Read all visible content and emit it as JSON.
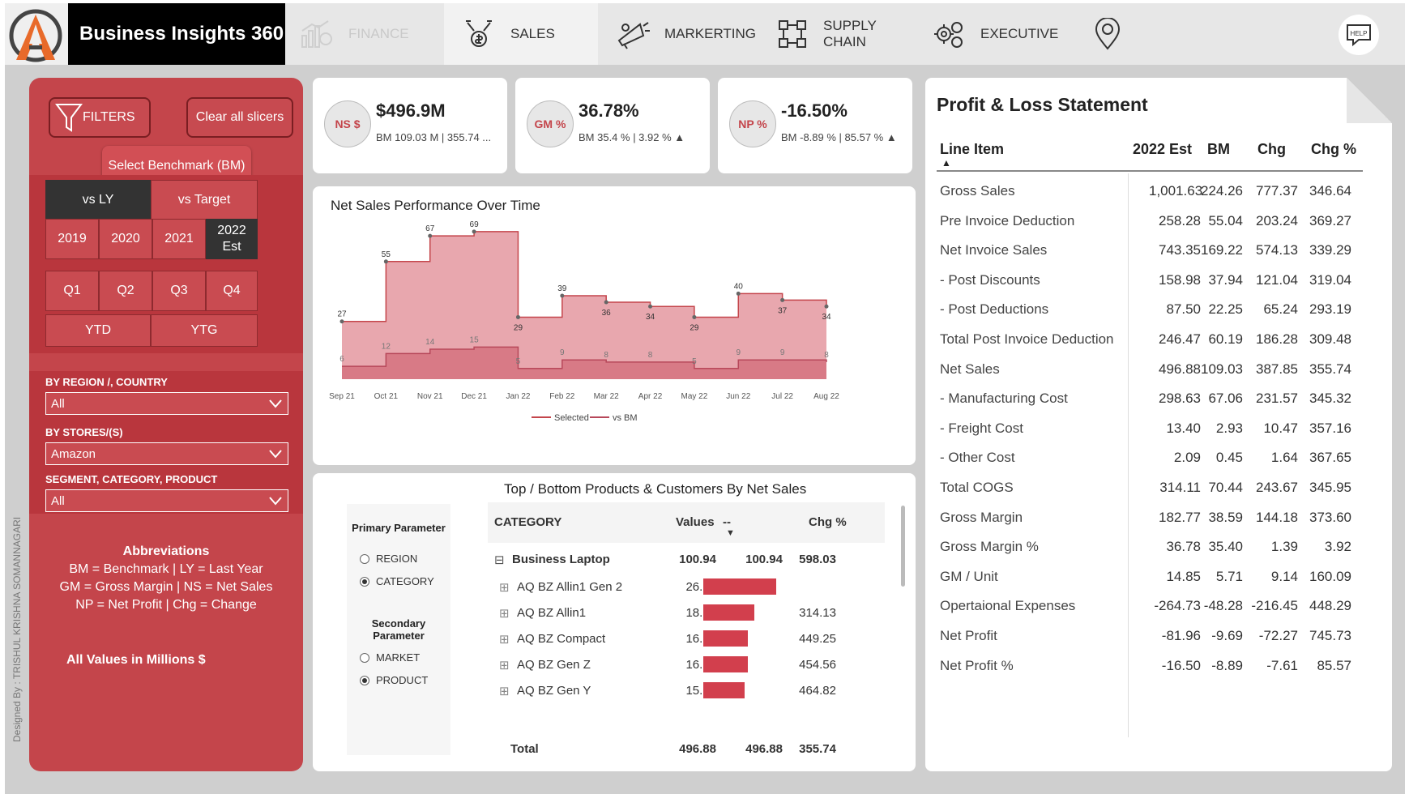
{
  "header": {
    "brand": "Business Insights 360",
    "nav": {
      "finance": "FINANCE",
      "sales": "SALES",
      "marketing": "MARKERTING",
      "supply_chain": "SUPPLY CHAIN",
      "executive": "EXECUTIVE"
    },
    "help_label": "HELP"
  },
  "filters": {
    "filters_label": "FILTERS",
    "clear_label": "Clear all slicers",
    "benchmark_label": "Select Benchmark (BM)",
    "compare": [
      "vs LY",
      "vs Target"
    ],
    "years": [
      "2019",
      "2020",
      "2021",
      "2022 Est"
    ],
    "quarters": [
      "Q1",
      "Q2",
      "Q3",
      "Q4"
    ],
    "periods": [
      "YTD",
      "YTG"
    ],
    "region_label": "BY REGION /, COUNTRY",
    "region_value": "All",
    "stores_label": "BY STORES/(S)",
    "stores_value": "Amazon",
    "segment_label": "SEGMENT, CATEGORY, PRODUCT",
    "segment_value": "All"
  },
  "abbreviations": {
    "title": "Abbreviations",
    "line1": "BM = Benchmark | LY = Last Year",
    "line2": "GM = Gross Margin | NS = Net Sales",
    "line3": "NP = Net Profit | Chg = Change",
    "note": "All Values in  Millions $"
  },
  "designer": "Designed By : TRISHUL KRISHNA SOMANNAGARI",
  "kpis": [
    {
      "badge": "NS $",
      "value": "$496.9M",
      "sub": "BM 109.03 M | 355.74 ..."
    },
    {
      "badge": "GM %",
      "value": "36.78%",
      "sub": "BM 35.4 % | 3.92 % ▲"
    },
    {
      "badge": "NP %",
      "value": "-16.50%",
      "sub": "BM -8.89 % | 85.57 % ▲"
    }
  ],
  "colors": {
    "accent": "#c4454b",
    "selected_area": "#e8a7ae",
    "bm_area": "#d87a86",
    "bar": "#d23f4d"
  },
  "chart_data": {
    "type": "area",
    "title": "Net Sales Performance Over Time",
    "categories": [
      "Sep 21",
      "Oct 21",
      "Nov 21",
      "Dec 21",
      "Jan 22",
      "Feb 22",
      "Mar 22",
      "Apr 22",
      "May 22",
      "Jun 22",
      "Jul 22",
      "Aug 22"
    ],
    "series": [
      {
        "name": "Selected",
        "values": [
          27,
          55,
          67,
          69,
          29,
          39,
          36,
          34,
          29,
          40,
          37,
          34
        ]
      },
      {
        "name": "vs BM",
        "values": [
          6,
          12,
          14,
          15,
          5,
          9,
          8,
          8,
          5,
          9,
          9,
          8
        ]
      }
    ],
    "ylim": [
      0,
      75
    ],
    "legend": "bottom"
  },
  "products": {
    "title": "Top / Bottom Products & Customers By Net Sales",
    "primary_label": "Primary Parameter",
    "primary_options": [
      "REGION",
      "CATEGORY"
    ],
    "secondary_label": "Secondary Parameter",
    "secondary_options": [
      "MARKET",
      "PRODUCT"
    ],
    "headers": {
      "category": "CATEGORY",
      "values": "Values",
      "sep": "--",
      "chg": "Chg %"
    },
    "group": {
      "name": "Business Laptop",
      "values": "100.94",
      "bm": "100.94",
      "chg": "598.03"
    },
    "rows": [
      {
        "name": "AQ BZ Allin1 Gen 2",
        "values": "26.64",
        "chg": ""
      },
      {
        "name": "AQ BZ Allin1",
        "values": "18.65",
        "chg": "314.13"
      },
      {
        "name": "AQ BZ Compact",
        "values": "16.26",
        "chg": "449.25"
      },
      {
        "name": "AQ BZ Gen Z",
        "values": "16.18",
        "chg": "454.56"
      },
      {
        "name": "AQ BZ Gen Y",
        "values": "15.23",
        "chg": "464.82"
      }
    ],
    "total": {
      "label": "Total",
      "values": "496.88",
      "bm": "496.88",
      "chg": "355.74"
    }
  },
  "pl": {
    "title": "Profit & Loss Statement",
    "headers": [
      "Line Item",
      "2022 Est",
      "BM",
      "Chg",
      "Chg %"
    ],
    "rows": [
      [
        "Gross Sales",
        "1,001.63",
        "224.26",
        "777.37",
        "346.64"
      ],
      [
        "Pre Invoice Deduction",
        "258.28",
        "55.04",
        "203.24",
        "369.27"
      ],
      [
        "Net Invoice Sales",
        "743.35",
        "169.22",
        "574.13",
        "339.29"
      ],
      [
        "- Post Discounts",
        "158.98",
        "37.94",
        "121.04",
        "319.04"
      ],
      [
        "- Post Deductions",
        "87.50",
        "22.25",
        "65.24",
        "293.19"
      ],
      [
        "Total Post Invoice Deduction",
        "246.47",
        "60.19",
        "186.28",
        "309.48"
      ],
      [
        "Net Sales",
        "496.88",
        "109.03",
        "387.85",
        "355.74"
      ],
      [
        "- Manufacturing Cost",
        "298.63",
        "67.06",
        "231.57",
        "345.32"
      ],
      [
        "- Freight Cost",
        "13.40",
        "2.93",
        "10.47",
        "357.16"
      ],
      [
        "- Other Cost",
        "2.09",
        "0.45",
        "1.64",
        "367.65"
      ],
      [
        "Total COGS",
        "314.11",
        "70.44",
        "243.67",
        "345.95"
      ],
      [
        "Gross Margin",
        "182.77",
        "38.59",
        "144.18",
        "373.60"
      ],
      [
        "Gross Margin %",
        "36.78",
        "35.40",
        "1.39",
        "3.92"
      ],
      [
        "GM / Unit",
        "14.85",
        "5.71",
        "9.14",
        "160.09"
      ],
      [
        "Opertaional Expenses",
        "-264.73",
        "-48.28",
        "-216.45",
        "448.29"
      ],
      [
        "Net Profit",
        "-81.96",
        "-9.69",
        "-72.27",
        "745.73"
      ],
      [
        "Net Profit %",
        "-16.50",
        "-8.89",
        "-7.61",
        "85.57"
      ]
    ]
  }
}
